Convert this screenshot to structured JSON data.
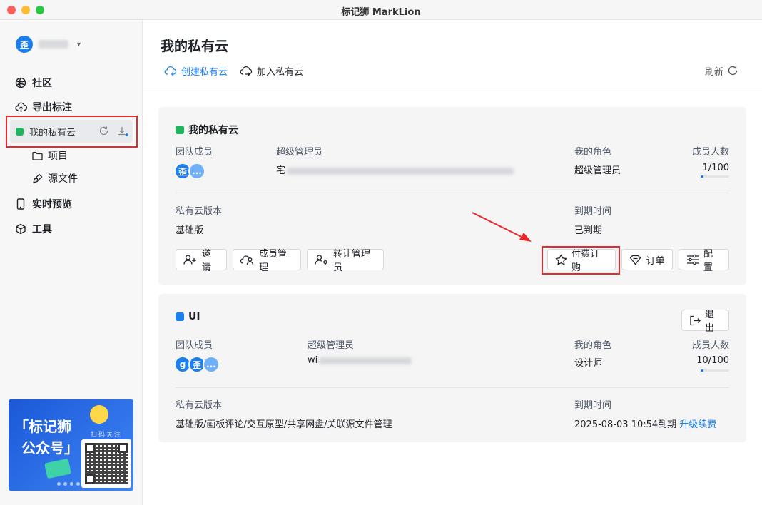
{
  "window": {
    "title": "标记狮 MarkLion"
  },
  "sidebar": {
    "user": {
      "avatar_text": "歪"
    },
    "nav": {
      "community": "社区",
      "export": "导出标注",
      "my_cloud": "我的私有云",
      "projects": "项目",
      "sources": "源文件",
      "live_preview": "实时预览",
      "tools": "工具"
    },
    "promo": {
      "line1": "「标记狮",
      "line2": "公众号」",
      "scan": "扫码关注"
    }
  },
  "main": {
    "title": "我的私有云",
    "toolbar": {
      "create": "创建私有云",
      "join": "加入私有云",
      "refresh": "刷新"
    },
    "cards": [
      {
        "name": "我的私有云",
        "color": "#22b35e",
        "members_label": "团队成员",
        "members": [
          "歪",
          "..."
        ],
        "admin_label": "超级管理员",
        "admin_prefix": "宅",
        "role_label": "我的角色",
        "role": "超级管理员",
        "count_label": "成员人数",
        "count": "1/100",
        "count_fraction": 0.1,
        "version_label": "私有云版本",
        "version": "基础版",
        "expire_label": "到期时间",
        "expire": "已到期",
        "buttons": {
          "invite": "邀请",
          "members": "成员管理",
          "transfer": "转让管理员",
          "subscribe": "付费订购",
          "orders": "订单",
          "config": "配置"
        }
      },
      {
        "name": "UI",
        "color": "#1b7ff0",
        "exit": "退出",
        "members_label": "团队成员",
        "members": [
          "g",
          "歪",
          "..."
        ],
        "admin_label": "超级管理员",
        "admin_prefix": "wi",
        "role_label": "我的角色",
        "role": "设计师",
        "count_label": "成员人数",
        "count": "10/100",
        "count_fraction": 0.1,
        "version_label": "私有云版本",
        "version": "基础版/画板评论/交互原型/共享网盘/关联源文件管理",
        "expire_label": "到期时间",
        "expire": "2025-08-03 10:54到期",
        "renew": "升级续费"
      }
    ]
  },
  "colors": {
    "accent": "#1b7ff0",
    "highlight": "#e8282b"
  },
  "icons": [
    "globe-icon",
    "cloud-upload-icon",
    "refresh-icon",
    "download-icon",
    "folder-icon",
    "pen-icon",
    "phone-icon",
    "cube-icon",
    "cloud-plus-icon",
    "user-plus-icon",
    "users-cloud-icon",
    "user-gear-icon",
    "star-icon",
    "tag-icon",
    "sliders-icon",
    "exit-icon"
  ]
}
